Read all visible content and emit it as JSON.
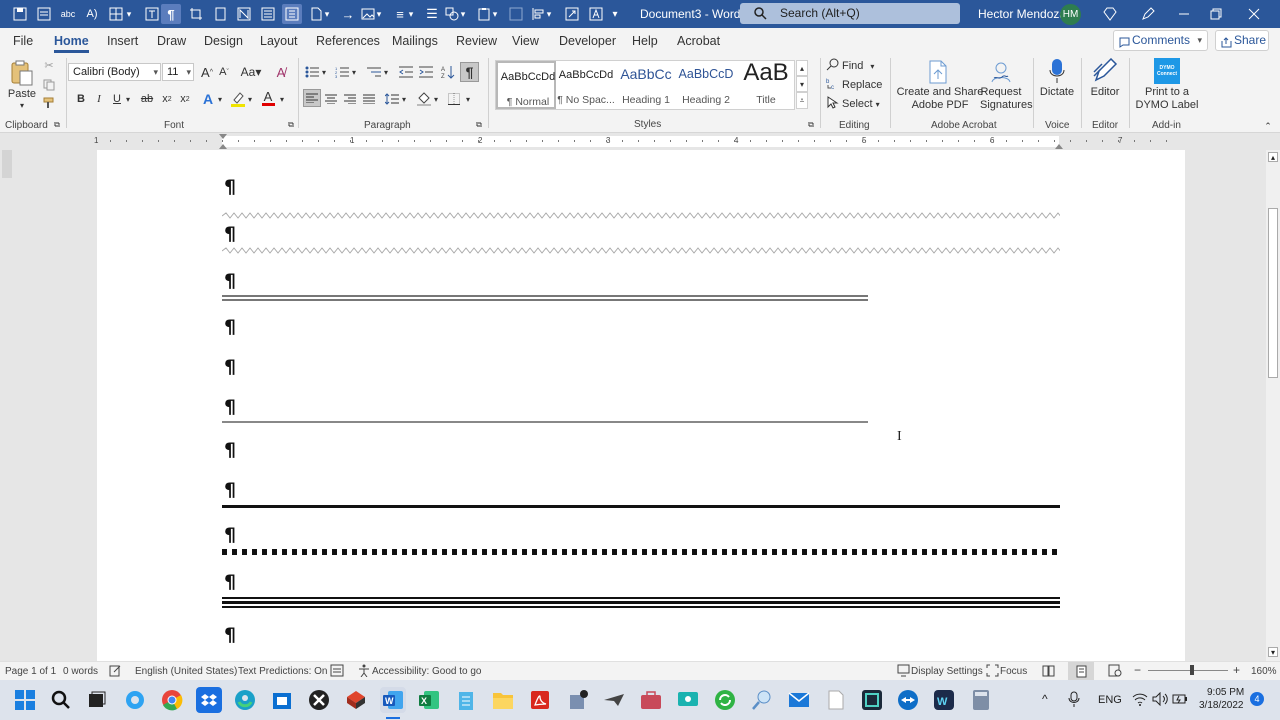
{
  "titlebar": {
    "document_title": "Document3 - Word",
    "search_placeholder": "Search (Alt+Q)",
    "user_name": "Hector Mendoza",
    "user_initials": "HM"
  },
  "menu": {
    "tabs": [
      "File",
      "Home",
      "Insert",
      "Draw",
      "Design",
      "Layout",
      "References",
      "Mailings",
      "Review",
      "View",
      "Developer",
      "Help",
      "Acrobat"
    ],
    "active_tab": "Home",
    "comments_label": "Comments",
    "share_label": "Share"
  },
  "ribbon": {
    "clipboard": {
      "paste_label": "Paste",
      "group_label": "Clipboard"
    },
    "font": {
      "font_name": "Calibri (Body)",
      "font_size": "11",
      "group_label": "Font"
    },
    "paragraph": {
      "group_label": "Paragraph"
    },
    "styles": {
      "group_label": "Styles",
      "items": [
        {
          "preview": "AaBbCcDd",
          "label": "¶ Normal"
        },
        {
          "preview": "AaBbCcDd",
          "label": "¶ No Spac..."
        },
        {
          "preview": "AaBbCc",
          "label": "Heading 1"
        },
        {
          "preview": "AaBbCcD",
          "label": "Heading 2"
        },
        {
          "preview": "AaB",
          "label": "Title"
        }
      ]
    },
    "editing": {
      "find": "Find",
      "replace": "Replace",
      "select": "Select",
      "group_label": "Editing"
    },
    "acrobat": {
      "create_share": "Create and Share Adobe PDF",
      "request_sig": "Request Signatures",
      "group_label": "Adobe Acrobat"
    },
    "voice": {
      "dictate": "Dictate",
      "group_label": "Voice"
    },
    "editor": {
      "editor": "Editor",
      "group_label": "Editor"
    },
    "addin": {
      "print_dymo": "Print to a DYMO Label",
      "dymo_logo": "DYMO Connect",
      "group_label": "Add-in"
    }
  },
  "ruler": {
    "numbers": [
      "1",
      "1",
      "2",
      "3",
      "4",
      "5",
      "6",
      "7"
    ]
  },
  "document": {
    "pilcrow": "¶"
  },
  "statusbar": {
    "page": "Page 1 of 1",
    "words": "0 words",
    "language": "English (United States)",
    "text_predictions": "Text Predictions: On",
    "accessibility": "Accessibility: Good to go",
    "display_settings": "Display Settings",
    "focus": "Focus",
    "zoom": "160%"
  },
  "taskbar": {
    "language": "ENG",
    "time": "9:05 PM",
    "date": "3/18/2022",
    "notification_count": "4"
  }
}
